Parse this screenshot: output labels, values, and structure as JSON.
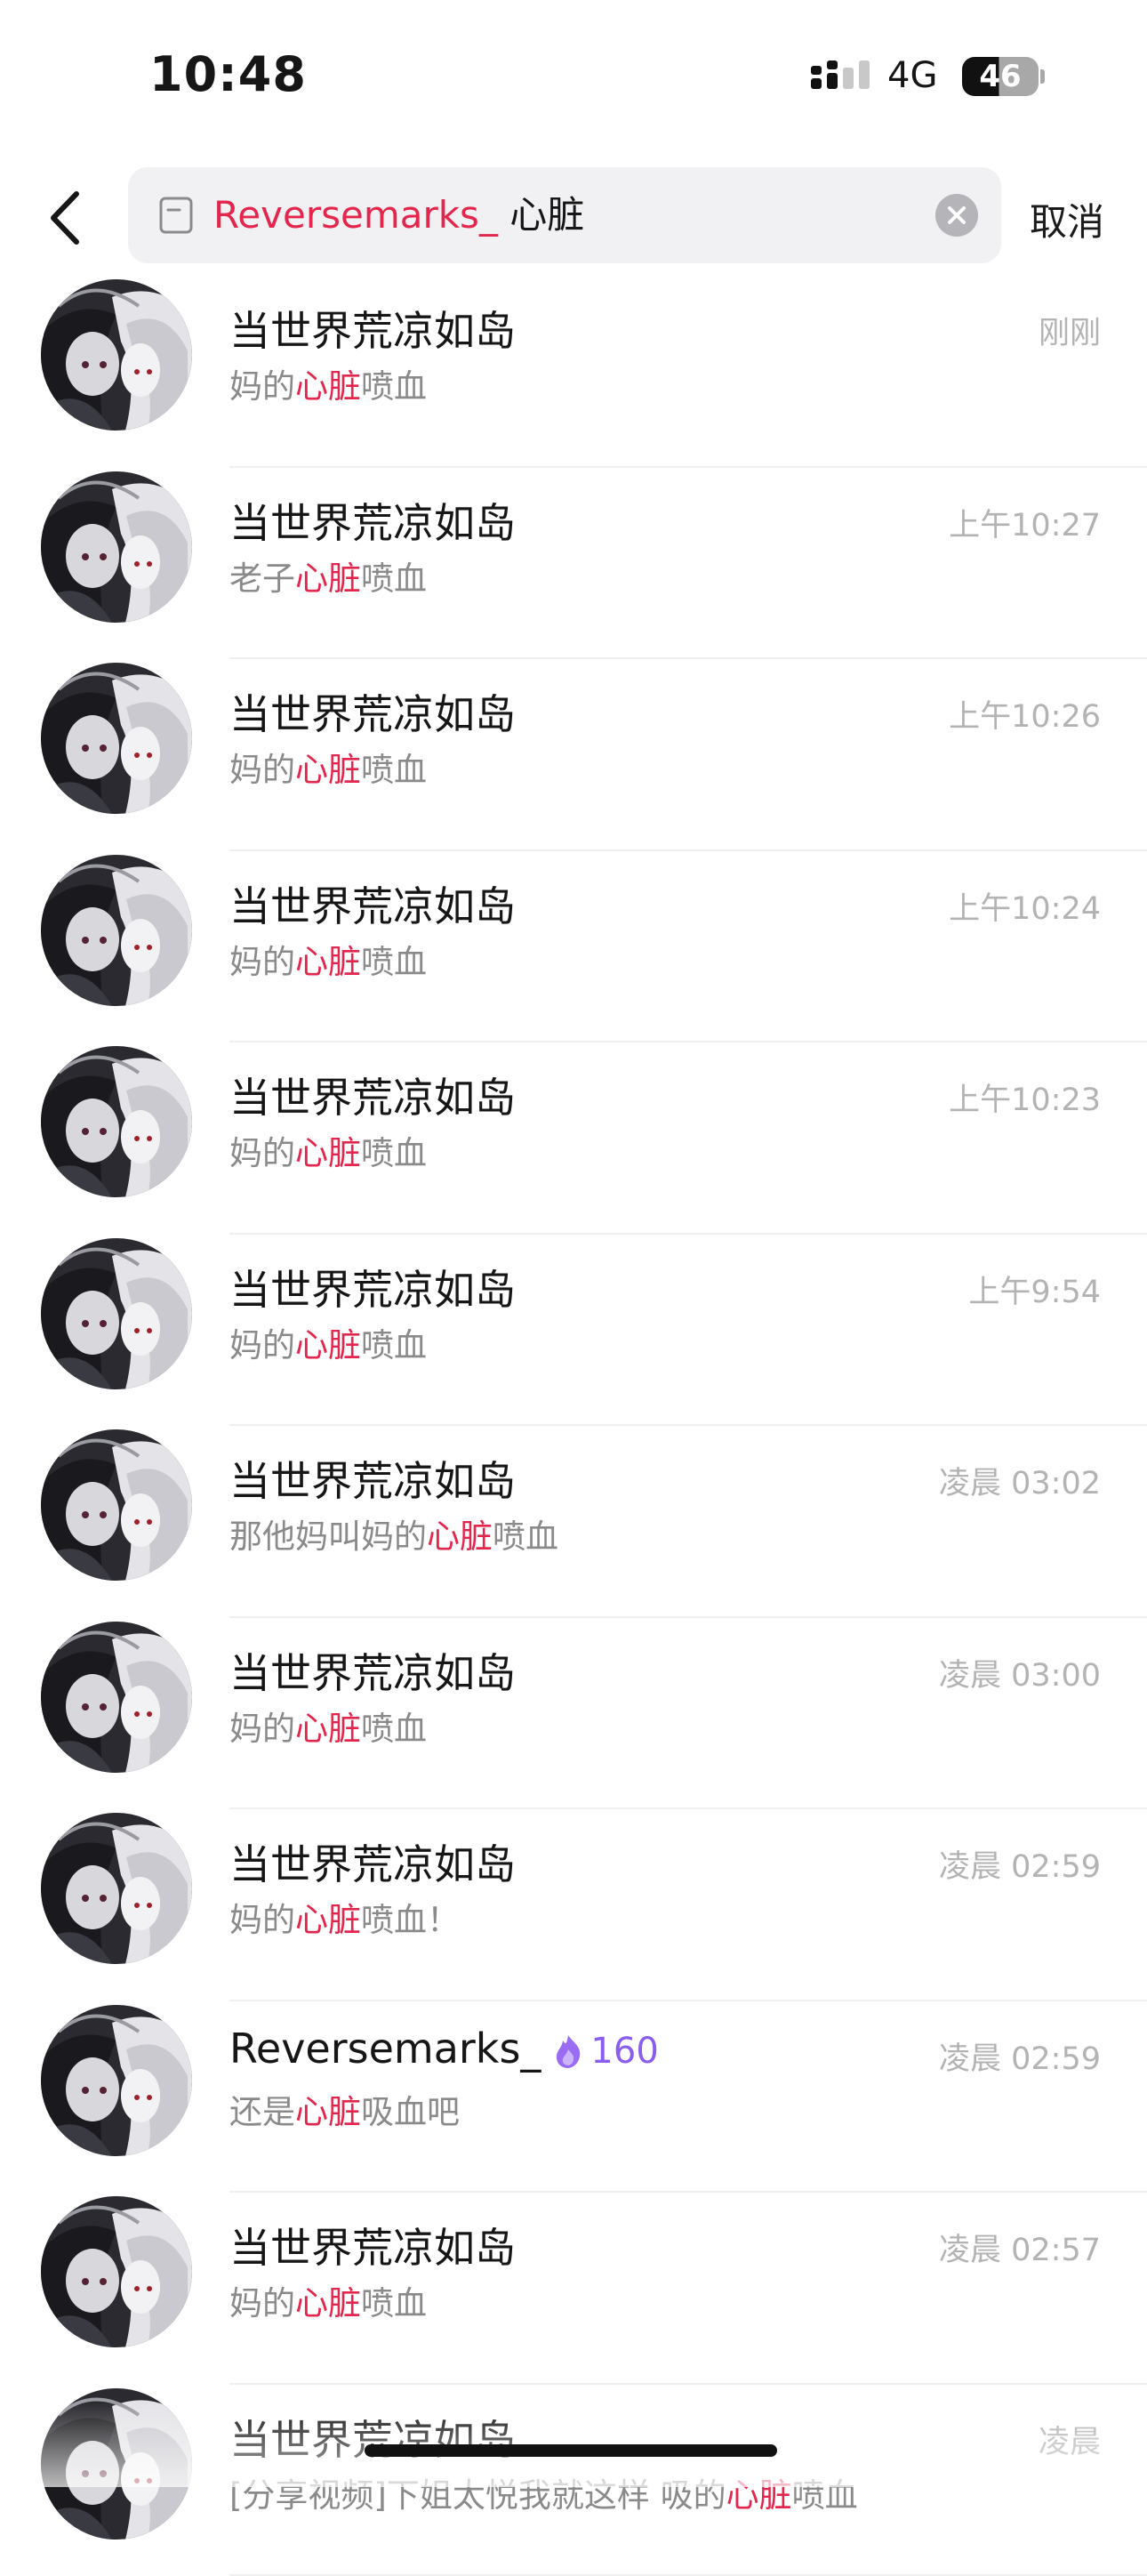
{
  "status_bar": {
    "time": "10:48",
    "network": "4G",
    "battery": "46"
  },
  "search": {
    "query_highlight": "Reversemarks_",
    "query_rest": " 心脏",
    "cancel_label": "取消",
    "accent_color": "#e4264d"
  },
  "results": [
    {
      "name": "当世界荒凉如岛",
      "pre": "妈的",
      "hl": "心脏",
      "post": "喷血",
      "time": "刚刚"
    },
    {
      "name": "当世界荒凉如岛",
      "pre": "老子",
      "hl": "心脏",
      "post": "喷血",
      "time": "上午10:27"
    },
    {
      "name": "当世界荒凉如岛",
      "pre": "妈的",
      "hl": "心脏",
      "post": "喷血",
      "time": "上午10:26"
    },
    {
      "name": "当世界荒凉如岛",
      "pre": "妈的",
      "hl": "心脏",
      "post": "喷血",
      "time": "上午10:24"
    },
    {
      "name": "当世界荒凉如岛",
      "pre": "妈的",
      "hl": "心脏",
      "post": "喷血",
      "time": "上午10:23"
    },
    {
      "name": "当世界荒凉如岛",
      "pre": "妈的",
      "hl": "心脏",
      "post": "喷血",
      "time": "上午9:54"
    },
    {
      "name": "当世界荒凉如岛",
      "pre": "那他妈叫妈的",
      "hl": "心脏",
      "post": "喷血",
      "time": "凌晨 03:02"
    },
    {
      "name": "当世界荒凉如岛",
      "pre": "妈的",
      "hl": "心脏",
      "post": "喷血",
      "time": "凌晨 03:00"
    },
    {
      "name": "当世界荒凉如岛",
      "pre": "妈的",
      "hl": "心脏",
      "post": "喷血！",
      "time": "凌晨 02:59"
    },
    {
      "name": "Reversemarks_",
      "pre": "还是",
      "hl": "心脏",
      "post": "吸血吧",
      "time": "凌晨 02:59",
      "badge": "160",
      "badge_icon": "purple-flame-icon",
      "badge_color": "#8a5cf0"
    },
    {
      "name": "当世界荒凉如岛",
      "pre": "妈的",
      "hl": "心脏",
      "post": "喷血",
      "time": "凌晨 02:57"
    },
    {
      "name": "当世界荒凉如岛",
      "pre": "[分享视频]下姐太悦我就这样 吸的",
      "hl": "心脏",
      "post": "喷血",
      "time": "凌晨"
    }
  ]
}
